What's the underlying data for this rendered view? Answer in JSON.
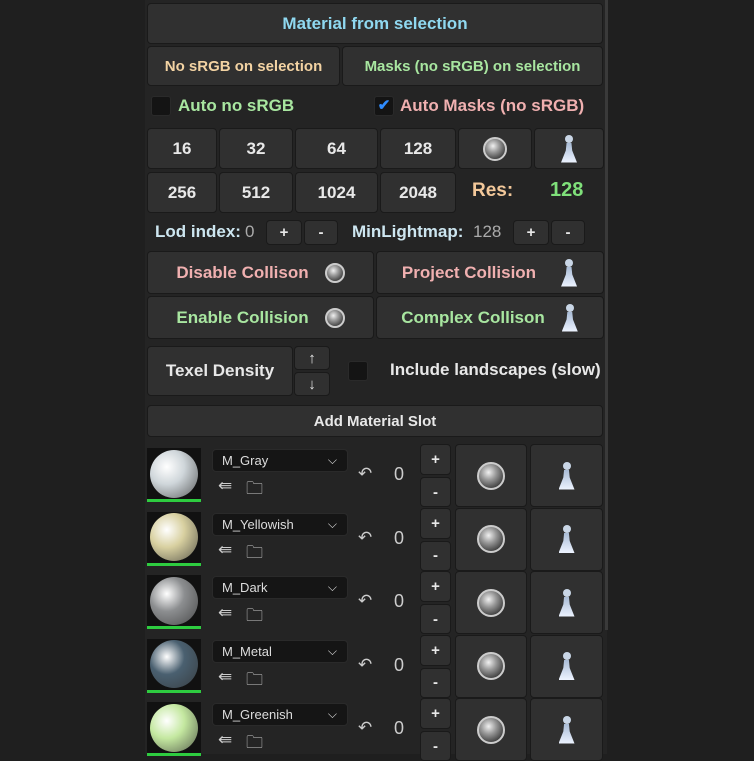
{
  "top": {
    "material_from_selection": "Material from selection",
    "no_srgb": "No sRGB on selection",
    "masks_no_srgb": "Masks (no sRGB) on selection",
    "auto_no_srgb": "Auto no sRGB",
    "auto_masks": "Auto Masks (no sRGB)",
    "auto_no_srgb_checked": false,
    "auto_masks_checked": true
  },
  "res": {
    "buttons": [
      "16",
      "32",
      "64",
      "128",
      "256",
      "512",
      "1024",
      "2048"
    ],
    "label": "Res:",
    "value": "128"
  },
  "lod": {
    "label": "Lod index:",
    "value": "0",
    "minlm_label": "MinLightmap:",
    "minlm_value": "128",
    "plus": "+",
    "minus": "-"
  },
  "collision": {
    "disable": "Disable Collison",
    "project": "Project Collision",
    "enable": "Enable Collision",
    "complex": "Complex Collison"
  },
  "texel": {
    "label": "Texel Density",
    "up": "↑",
    "down": "↓",
    "include_landscapes": "Include landscapes (slow)"
  },
  "add_slot": "Add Material Slot",
  "colors": {
    "cyan": "#8fd8f0",
    "peach": "#f3d3a3",
    "green": "#a8e6a0",
    "pink": "#f0b0b0",
    "res_value": "#7fe07a"
  },
  "materials": [
    {
      "name": "M_Gray",
      "lod": "0",
      "color": "#cfd6da"
    },
    {
      "name": "M_Yellowish",
      "lod": "0",
      "color": "#d8d0a0"
    },
    {
      "name": "M_Dark",
      "lod": "0",
      "color": "#8c8e90"
    },
    {
      "name": "M_Metal",
      "lod": "0",
      "color": "#4a6070"
    },
    {
      "name": "M_Greenish",
      "lod": "0",
      "color": "#c4e8a0"
    }
  ]
}
